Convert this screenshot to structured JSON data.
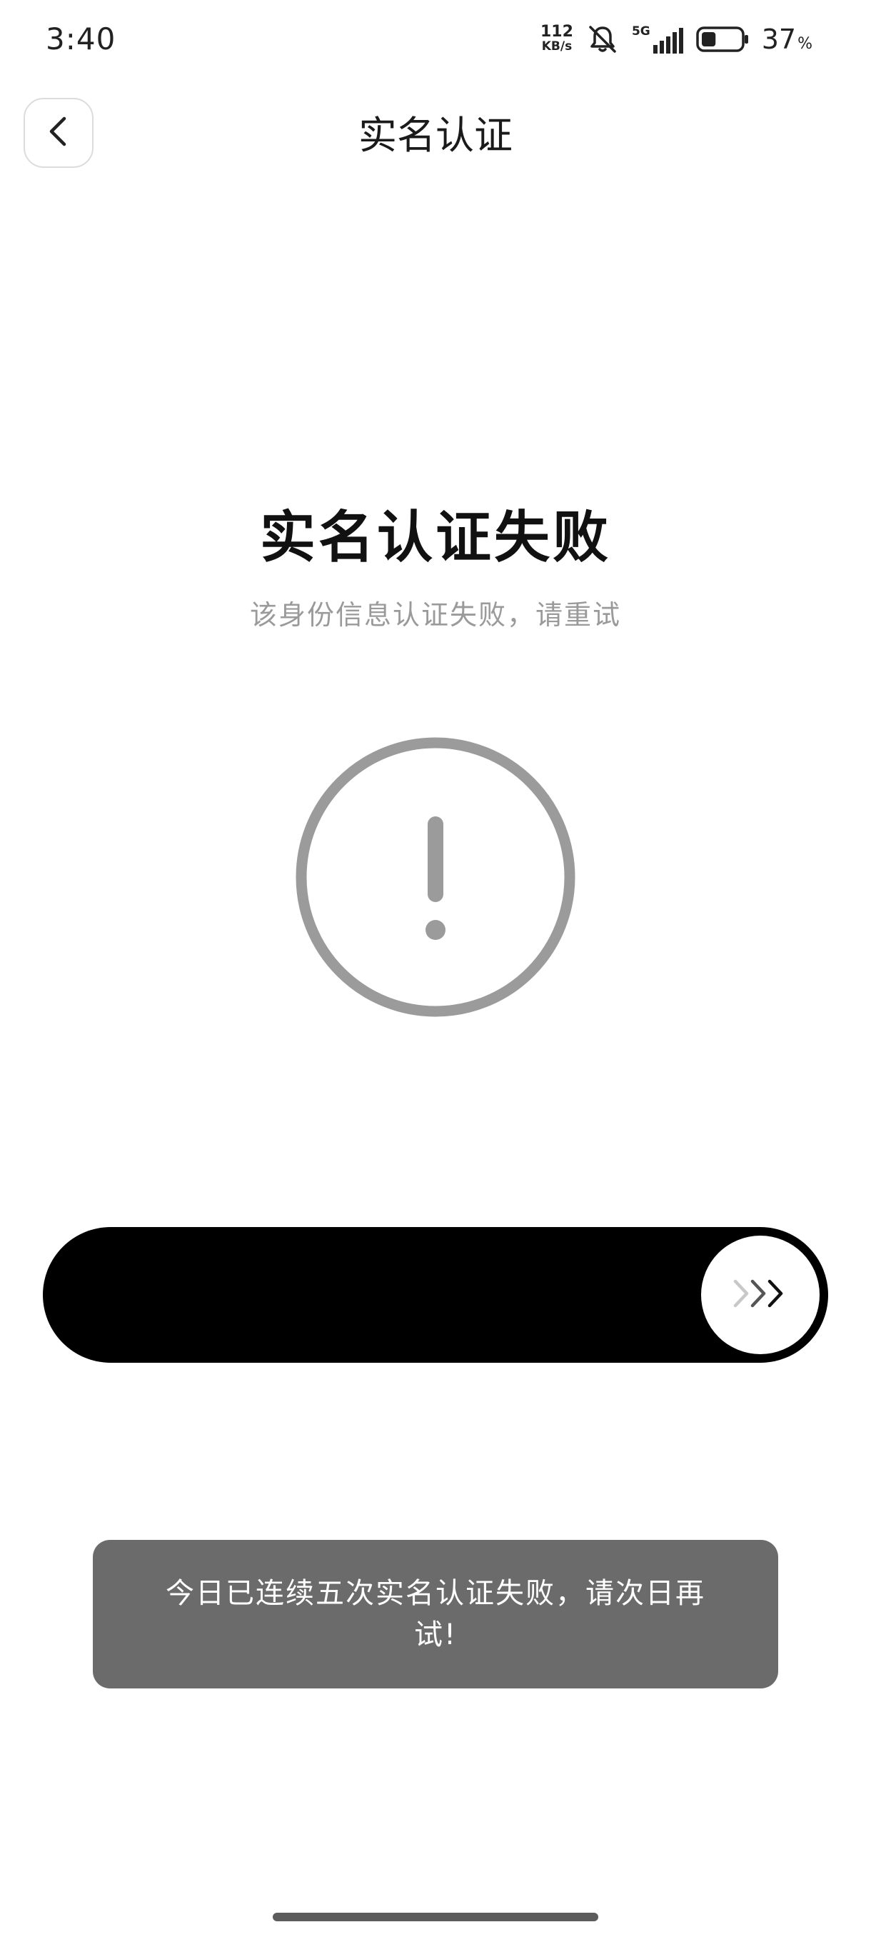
{
  "status_bar": {
    "time": "3:40",
    "net_speed_value": "112",
    "net_speed_unit": "KB/s",
    "network_type": "5G",
    "battery_percent": "37",
    "battery_percent_sign": "%",
    "battery_level": 0.37,
    "icons": [
      "mute-bell-icon",
      "signal-icon",
      "battery-icon"
    ]
  },
  "header": {
    "back_icon": "chevron-left-icon",
    "title": "实名认证"
  },
  "result": {
    "title": "实名认证失败",
    "subtitle": "该身份信息认证失败，请重试",
    "icon": "exclamation-circle-icon"
  },
  "slider": {
    "knob_icon": "triple-chevron-right-icon"
  },
  "toast": {
    "message": "今日已连续五次实名认证失败，请次日再试!"
  },
  "colors": {
    "icon_gray": "#9b9b9b",
    "slider_track": "#000000",
    "toast_bg": "#6b6b6b",
    "subtitle_gray": "#9a9a9a"
  }
}
